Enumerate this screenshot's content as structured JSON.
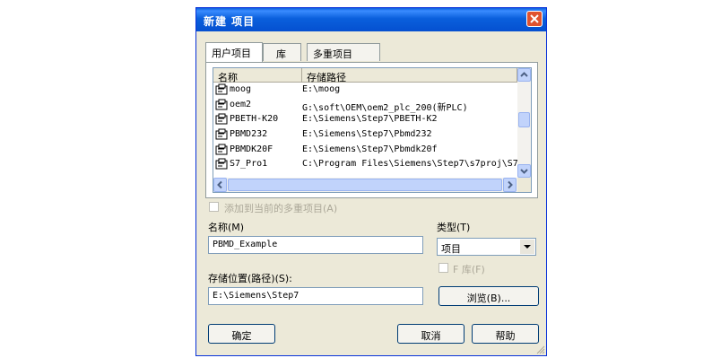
{
  "dialog": {
    "title": "新建 项目",
    "tabs": [
      "用户项目",
      "库",
      "多重项目"
    ],
    "list": {
      "columns": [
        "名称",
        "存储路径"
      ],
      "rows": [
        {
          "name": "moog",
          "path": "E:\\moog"
        },
        {
          "name": "oem2",
          "path": "G:\\soft\\OEM\\oem2_plc_200(新PLC)"
        },
        {
          "name": "PBETH-K20",
          "path": "E:\\Siemens\\Step7\\PBETH-K2"
        },
        {
          "name": "PBMD232",
          "path": "E:\\Siemens\\Step7\\Pbmd232"
        },
        {
          "name": "PBMDK20F",
          "path": "E:\\Siemens\\Step7\\Pbmdk20f"
        },
        {
          "name": "S7_Pro1",
          "path": "C:\\Program Files\\Siemens\\Step7\\s7proj\\S7"
        }
      ]
    },
    "add_to_multiproject_label": "添加到当前的多重项目(A)",
    "name_label": "名称(M)",
    "name_value": "PBMD_Example",
    "type_label": "类型(T)",
    "type_value": "项目",
    "f_library_label": "F 库(F)",
    "location_label": "存储位置(路径)(S):",
    "location_value": "E:\\Siemens\\Step7",
    "browse_label": "浏览(B)...",
    "ok_label": "确定",
    "cancel_label": "取消",
    "help_label": "帮助"
  }
}
